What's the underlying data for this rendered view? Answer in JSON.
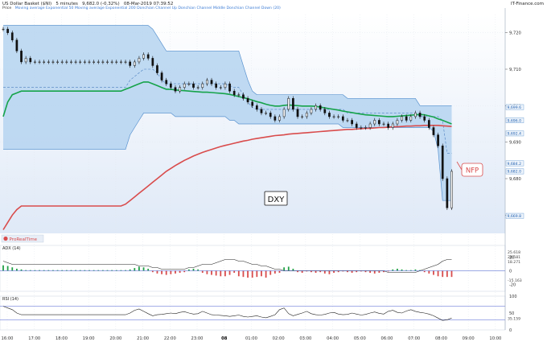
{
  "header": {
    "instrument": "US Dollar Basket ($NI)",
    "timeframe": "5 minutes",
    "quote": "9,682.0 (-0.32%)",
    "datetime": "08-Mar-2019 07:39:52",
    "source": "IT-Finance.com"
  },
  "legend_line": {
    "label": "Price",
    "items": "Moving average  Exponential 50  Moving average  Exponential 200  Donchian Channel Up Donchian Channel Middle Donchian Channel Down (20)"
  },
  "colors": {
    "candle": "#111111",
    "channel_fill": "#b5d3f0",
    "channel_line": "#5a93cf",
    "ema50": "#16a34a",
    "ema200": "#d94c4c",
    "annotation_red": "#d94c4c",
    "panel_bg_top": "#ffffff",
    "panel_bg_bottom": "#dfe9f7"
  },
  "chart_data": [
    {
      "type": "candlestick",
      "panel": "price",
      "title": "US Dollar Basket ($NI) 5 minutes",
      "x_ticks": [
        "16:00",
        "17:00",
        "18:00",
        "19:00",
        "20:00",
        "21:00",
        "22:00",
        "23:00",
        "08",
        "01:00",
        "02:00",
        "03:00",
        "04:00",
        "05:00",
        "06:00",
        "07:00",
        "08:00",
        "09:00",
        "10:00"
      ],
      "y_ticks": [
        9670,
        9680,
        9690,
        9700,
        9710,
        9720
      ],
      "y_tick_labels": [
        "9,670",
        "9,680",
        "9,690",
        "9,700",
        "9,710",
        "9,720"
      ],
      "ylim": [
        9665,
        9725
      ],
      "series": [
        {
          "name": "Price",
          "kind": "close",
          "values": [
            9721,
            9720,
            9718,
            9715,
            9712,
            9713,
            9712,
            9712,
            9712,
            9712,
            9712,
            9712,
            9712,
            9712,
            9712,
            9712,
            9712,
            9712,
            9712,
            9712,
            9712,
            9712,
            9712,
            9712,
            9712,
            9712,
            9712,
            9712,
            9711,
            9712,
            9713,
            9714,
            9713,
            9711,
            9709,
            9707,
            9706,
            9705,
            9704,
            9705,
            9706,
            9706,
            9705,
            9705,
            9706,
            9707,
            9706,
            9705,
            9705,
            9706,
            9704,
            9703,
            9703,
            9702,
            9701,
            9700,
            9699,
            9698,
            9698,
            9697,
            9696,
            9697,
            9699,
            9702,
            9699,
            9697,
            9697,
            9698,
            9699,
            9700,
            9699,
            9698,
            9697,
            9697,
            9697,
            9696,
            9696,
            9695,
            9694,
            9694,
            9694,
            9695,
            9696,
            9695,
            9695,
            9694,
            9695,
            9696,
            9697,
            9696,
            9697,
            9698,
            9697,
            9696,
            9694,
            9692,
            9689,
            9680,
            9672,
            9682
          ]
        },
        {
          "name": "Moving average Exponential 50",
          "values": [
            9697,
            9701,
            9703,
            9703.5,
            9704,
            9704,
            9704,
            9704,
            9704,
            9704,
            9704,
            9704,
            9704,
            9704,
            9704,
            9704,
            9704,
            9704,
            9704,
            9704,
            9704,
            9704,
            9704,
            9704,
            9704,
            9704,
            9704,
            9704.5,
            9705,
            9705.5,
            9706,
            9706.5,
            9706.5,
            9706,
            9705.5,
            9705,
            9704.5,
            9704.5,
            9704.3,
            9704.2,
            9704.1,
            9704,
            9703.9,
            9703.8,
            9703.7,
            9703.7,
            9703.6,
            9703.5,
            9703.4,
            9703.3,
            9703.1,
            9702.8,
            9702.5,
            9702.2,
            9701.9,
            9701.5,
            9701.1,
            9700.8,
            9700.4,
            9700.1,
            9699.9,
            9699.9,
            9700.1,
            9700.2,
            9700.1,
            9700,
            9699.9,
            9699.9,
            9699.9,
            9699.8,
            9699.6,
            9699.4,
            9699.2,
            9699,
            9698.8,
            9698.5,
            9698.3,
            9698.1,
            9697.9,
            9697.7,
            9697.5,
            9697.4,
            9697.3,
            9697.2,
            9697.1,
            9697,
            9697,
            9697.1,
            9697.2,
            9697.3,
            9697.4,
            9697.5,
            9697.6,
            9697.5,
            9697.2,
            9696.9,
            9696.4,
            9696,
            9695.5,
            9695
          ]
        },
        {
          "name": "Moving average Exponential 200",
          "values": [
            9666,
            9668,
            9670,
            9671.5,
            9672.5,
            9672.5,
            9672.5,
            9672.5,
            9672.5,
            9672.5,
            9672.5,
            9672.5,
            9672.5,
            9672.5,
            9672.5,
            9672.5,
            9672.5,
            9672.5,
            9672.5,
            9672.5,
            9672.5,
            9672.5,
            9672.5,
            9672.5,
            9672.5,
            9672.5,
            9672.5,
            9673,
            9674,
            9675,
            9676,
            9677,
            9678,
            9679,
            9680,
            9681,
            9682,
            9682.8,
            9683.6,
            9684.3,
            9685,
            9685.6,
            9686.2,
            9686.7,
            9687.2,
            9687.6,
            9688,
            9688.4,
            9688.8,
            9689.1,
            9689.4,
            9689.7,
            9690,
            9690.3,
            9690.5,
            9690.8,
            9691,
            9691.2,
            9691.4,
            9691.6,
            9691.8,
            9691.9,
            9692,
            9692.2,
            9692.3,
            9692.4,
            9692.5,
            9692.6,
            9692.7,
            9692.8,
            9692.9,
            9693,
            9693.1,
            9693.2,
            9693.3,
            9693.4,
            9693.5,
            9693.5,
            9693.6,
            9693.7,
            9693.8,
            9693.8,
            9693.9,
            9694,
            9694,
            9694.1,
            9694.2,
            9694.2,
            9694.3,
            9694.4,
            9694.4,
            9694.5,
            9694.5,
            9694.6,
            9694.6,
            9694.6,
            9694.6,
            9694.5,
            9694.4,
            9694.3
          ]
        },
        {
          "name": "Donchian Channel Up",
          "values": [
            9722,
            9722,
            9722,
            9722,
            9722,
            9722,
            9722,
            9722,
            9722,
            9722,
            9722,
            9722,
            9722,
            9722,
            9722,
            9722,
            9722,
            9722,
            9722,
            9722,
            9722,
            9722,
            9722,
            9722,
            9722,
            9722,
            9722,
            9722,
            9722,
            9722,
            9722,
            9722,
            9722,
            9721,
            9719,
            9717,
            9715,
            9715,
            9715,
            9715,
            9715,
            9715,
            9715,
            9715,
            9715,
            9715,
            9715,
            9715,
            9715,
            9715,
            9715,
            9715,
            9715,
            9711,
            9707,
            9704,
            9703,
            9703,
            9703,
            9703,
            9703,
            9703,
            9703,
            9703,
            9703,
            9703,
            9703,
            9703,
            9703,
            9703,
            9703,
            9703,
            9703,
            9703,
            9703,
            9703,
            9702,
            9702,
            9702,
            9702,
            9702,
            9702,
            9702,
            9702,
            9702,
            9702,
            9702,
            9702,
            9702,
            9702,
            9702,
            9702,
            9700,
            9700,
            9700,
            9700,
            9700,
            9700,
            9700,
            9700
          ]
        },
        {
          "name": "Donchian Channel Middle",
          "values": [
            9705,
            9705,
            9705,
            9705,
            9705,
            9705,
            9705,
            9705,
            9705,
            9705,
            9705,
            9705,
            9705,
            9705,
            9705,
            9705,
            9705,
            9705,
            9705,
            9705,
            9705,
            9705,
            9705,
            9705,
            9705,
            9705,
            9705,
            9705,
            9707,
            9708,
            9709,
            9710,
            9710,
            9710,
            9709,
            9707,
            9706,
            9706,
            9706,
            9706,
            9706,
            9706,
            9706,
            9706,
            9706,
            9706,
            9706,
            9706,
            9706,
            9706,
            9705.5,
            9705,
            9705,
            9703,
            9701,
            9699.5,
            9699,
            9699,
            9699,
            9699,
            9699,
            9699,
            9699,
            9699,
            9699,
            9699,
            9699,
            9699,
            9699,
            9699,
            9699,
            9699,
            9699,
            9699,
            9699,
            9699,
            9698,
            9698,
            9698,
            9698,
            9698,
            9698,
            9698,
            9698,
            9698,
            9698,
            9698,
            9698,
            9698,
            9698,
            9698,
            9698,
            9697,
            9697,
            9697,
            9697,
            9697,
            9696,
            9687,
            9687
          ]
        },
        {
          "name": "Donchian Channel Down",
          "values": [
            9688,
            9688,
            9688,
            9688,
            9688,
            9688,
            9688,
            9688,
            9688,
            9688,
            9688,
            9688,
            9688,
            9688,
            9688,
            9688,
            9688,
            9688,
            9688,
            9688,
            9688,
            9688,
            9688,
            9688,
            9688,
            9688,
            9688,
            9688,
            9692,
            9694,
            9696,
            9698,
            9698,
            9698,
            9698,
            9698,
            9698,
            9698,
            9697,
            9697,
            9697,
            9697,
            9697,
            9697,
            9697,
            9697,
            9697,
            9697,
            9697,
            9697,
            9696,
            9696,
            9695,
            9695,
            9695,
            9695,
            9695,
            9695,
            9695,
            9695,
            9695,
            9695,
            9695,
            9695,
            9695,
            9695,
            9695,
            9695,
            9695,
            9695,
            9695,
            9695,
            9695,
            9695,
            9695,
            9694,
            9694,
            9694,
            9694,
            9694,
            9694,
            9694,
            9694,
            9694,
            9694,
            9694,
            9694,
            9694,
            9694,
            9694,
            9694,
            9694,
            9694,
            9694,
            9694,
            9693,
            9688,
            9674,
            9674,
            9674
          ]
        }
      ],
      "right_axis_labels": [
        "9,699.6",
        "9,696.0",
        "9,692.4",
        "9,684.2",
        "9,682.0",
        "9,669.8"
      ],
      "annotations": [
        {
          "text": "DXY",
          "style": "boxed"
        },
        {
          "text": "NFP",
          "style": "red-callout"
        }
      ],
      "watermark": "ProRealTime"
    },
    {
      "type": "area+histogram",
      "panel": "adx",
      "title": "ADX (14)",
      "y_ticks": [
        20,
        0,
        -20
      ],
      "y_tick_labels": [
        "20",
        "0",
        "-20"
      ],
      "right_axis_labels": [
        "25.618",
        "20.581",
        "18.271",
        "-15.163"
      ],
      "series": [
        {
          "name": "ADX",
          "values": [
            20,
            19,
            18,
            18,
            18,
            18,
            18,
            18,
            18,
            18,
            18,
            18,
            18,
            18,
            18,
            18,
            18,
            18,
            18,
            18,
            18,
            18,
            18,
            18,
            18,
            18,
            18,
            18,
            18,
            18,
            17,
            17,
            17,
            16,
            16,
            15,
            15,
            15,
            15,
            15,
            15,
            16,
            16,
            17,
            18,
            18,
            18,
            19,
            20,
            21,
            21,
            21,
            20,
            20,
            19,
            18,
            18,
            17,
            17,
            16,
            15,
            15,
            14,
            14,
            14,
            14,
            14,
            14,
            14,
            14,
            14,
            14,
            14,
            14,
            14,
            14,
            14,
            14,
            14,
            14,
            14,
            14,
            14,
            14,
            14,
            13,
            13,
            13,
            13,
            13,
            13,
            13,
            14,
            15,
            16,
            17,
            18,
            20,
            21,
            21
          ]
        },
        {
          "name": "histogram",
          "values": [
            8,
            7,
            5,
            3,
            2,
            1,
            1,
            1,
            1,
            1,
            1,
            1,
            1,
            1,
            1,
            1,
            1,
            1,
            1,
            1,
            1,
            1,
            1,
            1,
            1,
            1,
            1,
            1,
            2,
            4,
            6,
            5,
            3,
            -2,
            -4,
            -5,
            -6,
            -5,
            -4,
            -3,
            -2,
            2,
            3,
            2,
            -3,
            -5,
            -6,
            -7,
            -8,
            -8,
            -6,
            -3,
            -8,
            -9,
            -10,
            -10,
            -9,
            -8,
            -10,
            -6,
            -4,
            -3,
            5,
            6,
            3,
            -2,
            -3,
            -1,
            -2,
            -3,
            -2,
            -4,
            -5,
            -3,
            -2,
            -1,
            -2,
            -3,
            -2,
            -1,
            -2,
            -3,
            -4,
            -3,
            -2,
            -1,
            2,
            3,
            2,
            1,
            1,
            2,
            1,
            -2,
            -4,
            -6,
            -8,
            -9,
            -9,
            -9
          ]
        }
      ]
    },
    {
      "type": "line",
      "panel": "rsi",
      "title": "RSI (14)",
      "y_ticks": [
        100,
        50,
        0
      ],
      "y_tick_labels": [
        "100",
        "50",
        "0"
      ],
      "right_axis_labels": [
        "35.159"
      ],
      "series": [
        {
          "name": "RSI",
          "values": [
            70,
            65,
            60,
            50,
            45,
            45,
            45,
            45,
            45,
            45,
            45,
            45,
            45,
            45,
            45,
            45,
            45,
            45,
            45,
            45,
            45,
            45,
            45,
            45,
            45,
            45,
            45,
            45,
            50,
            58,
            62,
            55,
            48,
            42,
            45,
            46,
            48,
            50,
            48,
            52,
            54,
            50,
            47,
            48,
            55,
            50,
            45,
            44,
            43,
            42,
            40,
            42,
            44,
            40,
            38,
            40,
            42,
            38,
            36,
            40,
            45,
            60,
            65,
            48,
            42,
            46,
            50,
            55,
            48,
            45,
            44,
            46,
            50,
            52,
            47,
            45,
            46,
            50,
            47,
            44,
            46,
            50,
            53,
            49,
            47,
            55,
            58,
            52,
            50,
            56,
            60,
            55,
            52,
            50,
            47,
            42,
            35,
            28,
            30,
            35
          ]
        }
      ]
    }
  ]
}
